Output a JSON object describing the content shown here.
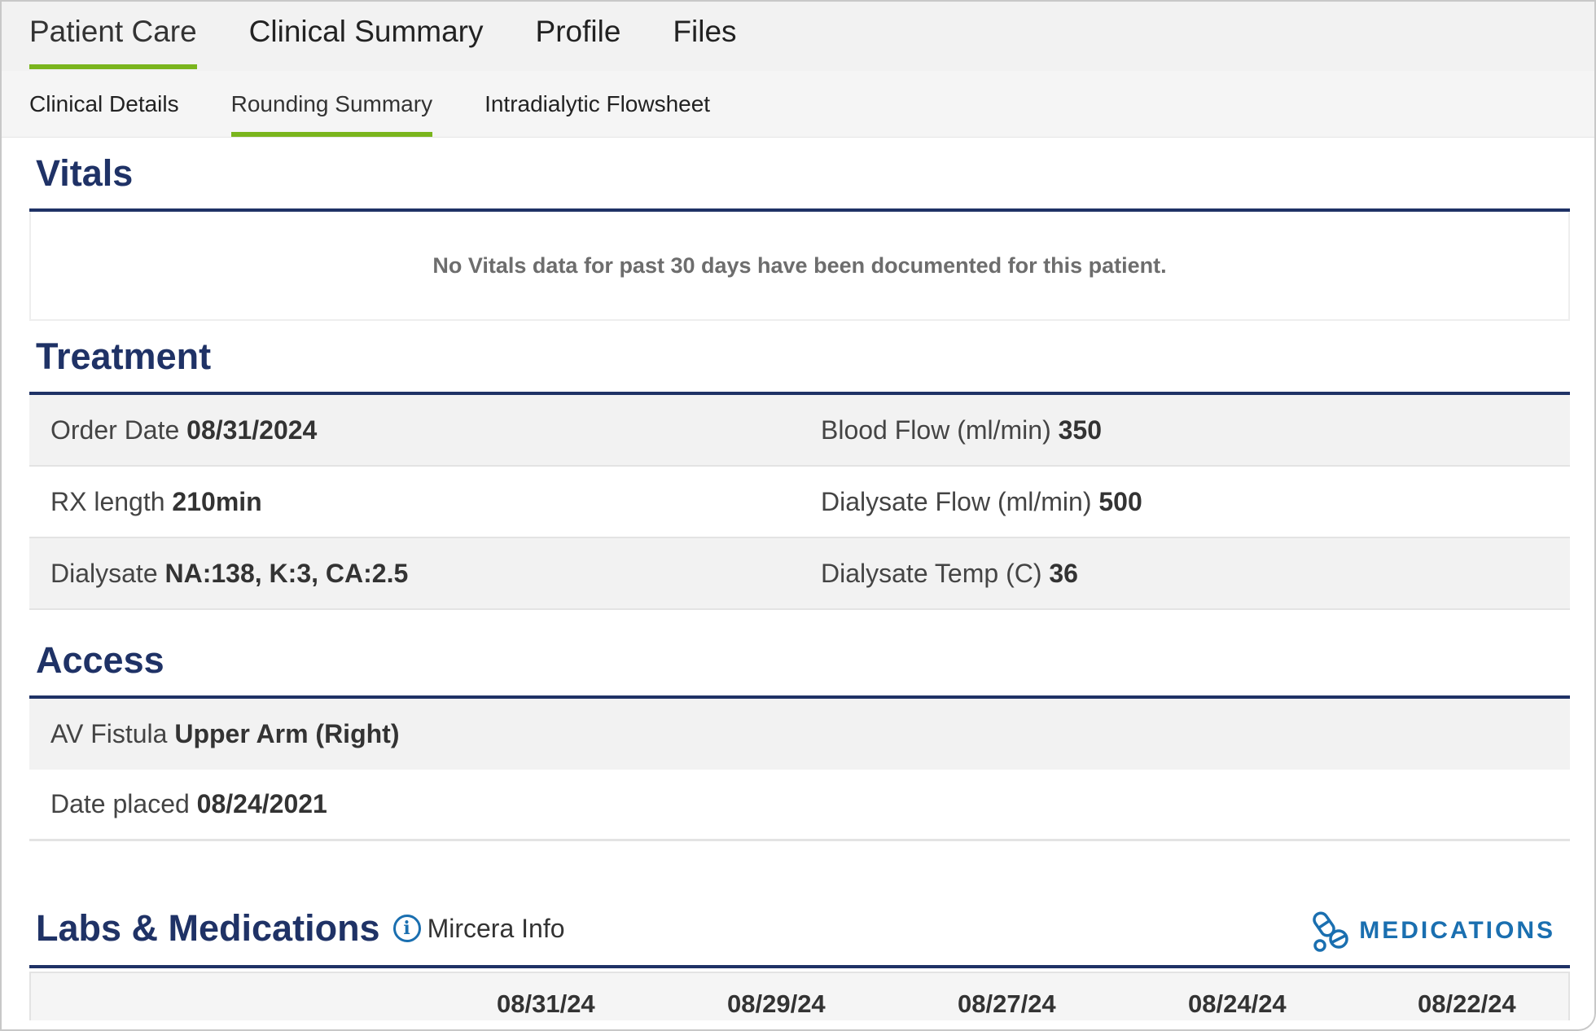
{
  "top_tabs": [
    {
      "label": "Patient Care",
      "active": true
    },
    {
      "label": "Clinical Summary",
      "active": false
    },
    {
      "label": "Profile",
      "active": false
    },
    {
      "label": "Files",
      "active": false
    }
  ],
  "sub_tabs": [
    {
      "label": "Clinical Details",
      "active": false
    },
    {
      "label": "Rounding Summary",
      "active": true
    },
    {
      "label": "Intradialytic Flowsheet",
      "active": false
    }
  ],
  "vitals": {
    "title": "Vitals",
    "empty_message": "No Vitals data for past 30 days have been documented for this patient."
  },
  "treatment": {
    "title": "Treatment",
    "rows": [
      [
        {
          "label": "Order Date",
          "value": "08/31/2024"
        },
        {
          "label": "Blood Flow (ml/min)",
          "value": "350"
        }
      ],
      [
        {
          "label": "RX length",
          "value": "210min"
        },
        {
          "label": "Dialysate Flow (ml/min)",
          "value": "500"
        }
      ],
      [
        {
          "label": "Dialysate",
          "value": "NA:138, K:3, CA:2.5"
        },
        {
          "label": "Dialysate Temp (C)",
          "value": "36"
        }
      ]
    ]
  },
  "access": {
    "title": "Access",
    "rows": [
      {
        "label": "AV Fistula",
        "value": "Upper Arm (Right)"
      },
      {
        "label": "Date placed",
        "value": "08/24/2021"
      }
    ]
  },
  "labs": {
    "title": "Labs & Medications",
    "mircera_label": "Mircera Info",
    "medications_button": "MEDICATIONS",
    "dates": [
      "08/31/24",
      "08/29/24",
      "08/27/24",
      "08/24/24",
      "08/22/24"
    ]
  },
  "colors": {
    "accent_green": "#7ab51d",
    "heading_navy": "#1f3266",
    "link_blue": "#1a6fb0"
  }
}
